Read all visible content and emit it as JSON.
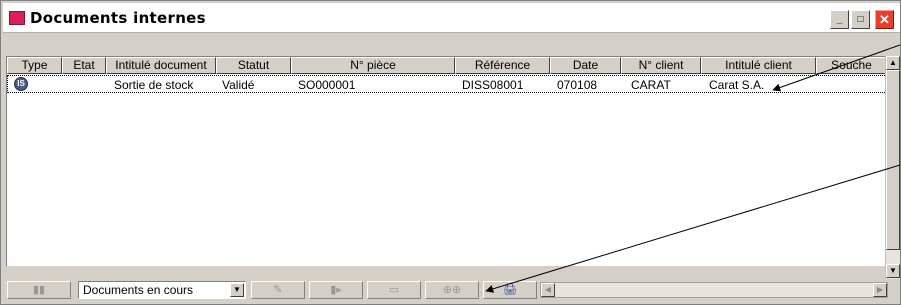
{
  "window": {
    "title": "Documents internes",
    "minimize_glyph": "_",
    "maximize_glyph": "□",
    "close_glyph": "✕"
  },
  "columns": [
    "Type",
    "Etat",
    "Intitulé document",
    "Statut",
    "N° pièce",
    "Référence",
    "Date",
    "N° client",
    "Intitulé client",
    "Souche"
  ],
  "rows": [
    {
      "type_icon_text": "IS",
      "etat": "",
      "intitule_document": "Sortie de stock",
      "statut": "Validé",
      "numero_piece": "SO000001",
      "reference": "DISS08001",
      "date": "070108",
      "numero_client": "CARAT",
      "intitule_client": "Carat S.A.",
      "souche": ""
    }
  ],
  "statusbar": {
    "filter_select_value": "Documents en cours",
    "tool_glyphs": [
      "▮▮",
      "✎",
      "▮▸",
      "▭",
      "⊕⊕",
      "🖨"
    ]
  },
  "colors": {
    "title_icon": "#d8205a",
    "close_button": "#e8412b",
    "annotation_arrow": "#000000"
  }
}
